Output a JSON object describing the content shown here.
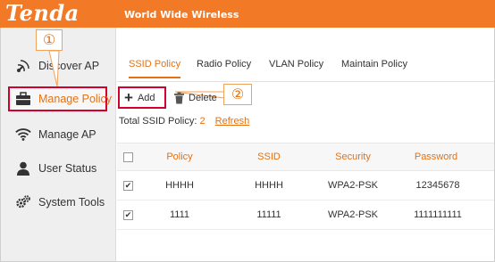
{
  "header": {
    "logo": "Tenda",
    "tagline": "World Wide Wireless"
  },
  "sidebar": {
    "items": [
      {
        "label": "Discover AP",
        "icon": "satellite-icon"
      },
      {
        "label": "Manage Policy",
        "icon": "briefcase-icon"
      },
      {
        "label": "Manage AP",
        "icon": "wifi-icon"
      },
      {
        "label": "User Status",
        "icon": "user-icon"
      },
      {
        "label": "System Tools",
        "icon": "gears-icon"
      }
    ]
  },
  "tabs": [
    "SSID Policy",
    "Radio Policy",
    "VLAN Policy",
    "Maintain Policy"
  ],
  "toolbar": {
    "add_label": "Add",
    "delete_label": "Delete"
  },
  "summary": {
    "prefix": "Total SSID Policy:",
    "count": "2",
    "refresh": "Refresh"
  },
  "table": {
    "columns": [
      "Policy",
      "SSID",
      "Security",
      "Password"
    ],
    "rows": [
      {
        "policy": "HHHH",
        "ssid": "HHHH",
        "security": "WPA2-PSK",
        "password": "12345678"
      },
      {
        "policy": "1111",
        "ssid": "11111",
        "security": "WPA2-PSK",
        "password": "1111111111"
      }
    ]
  },
  "annotations": {
    "marker1": "①",
    "marker2": "②"
  },
  "colors": {
    "brand": "#f27a26",
    "accent": "#e8700f",
    "highlight": "#d2002b"
  }
}
